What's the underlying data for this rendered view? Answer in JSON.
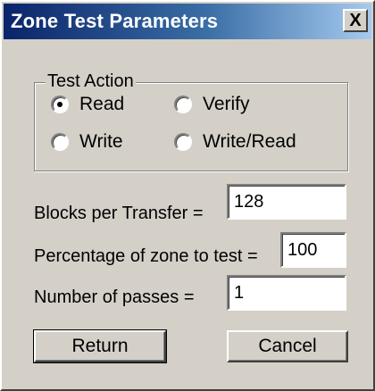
{
  "window": {
    "title": "Zone Test Parameters",
    "close_symbol": "X"
  },
  "test_action": {
    "legend": "Test Action",
    "options": [
      {
        "label": "Read",
        "checked": true
      },
      {
        "label": "Verify",
        "checked": false
      },
      {
        "label": "Write",
        "checked": false
      },
      {
        "label": "Write/Read",
        "checked": false
      }
    ]
  },
  "fields": {
    "blocks_per_transfer": {
      "label": "Blocks per Transfer =",
      "value": "128"
    },
    "percentage_of_zone": {
      "label": "Percentage of zone to test =",
      "value": "100"
    },
    "number_of_passes": {
      "label": "Number of passes =",
      "value": "1"
    }
  },
  "buttons": {
    "return_label": "Return",
    "cancel_label": "Cancel"
  }
}
